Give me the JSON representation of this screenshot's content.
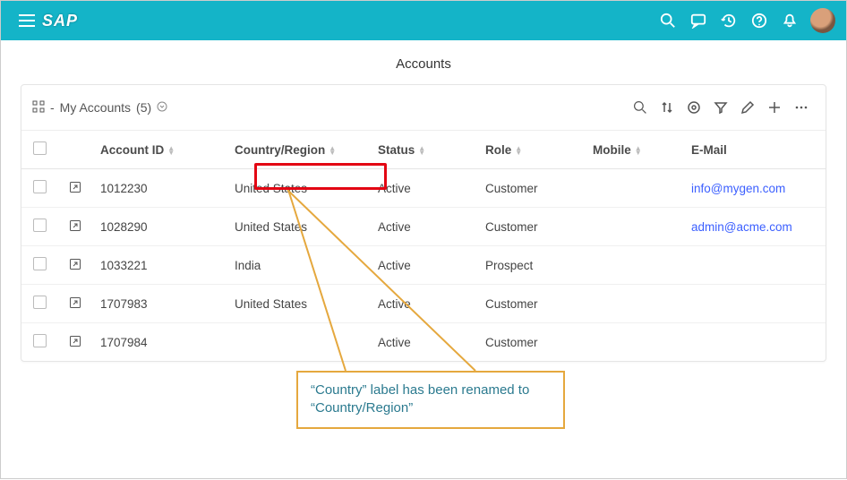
{
  "header": {
    "logo_text": "SAP"
  },
  "page": {
    "title": "Accounts"
  },
  "toolbar": {
    "view_label": "My Accounts",
    "count": "(5)"
  },
  "columns": {
    "account_id": "Account ID",
    "country_region": "Country/Region",
    "status": "Status",
    "role": "Role",
    "mobile": "Mobile",
    "email": "E-Mail"
  },
  "rows": [
    {
      "account_id": "1012230",
      "country": "United States",
      "status": "Active",
      "role": "Customer",
      "mobile": "",
      "email": "info@mygen.com"
    },
    {
      "account_id": "1028290",
      "country": "United States",
      "status": "Active",
      "role": "Customer",
      "mobile": "",
      "email": "admin@acme.com"
    },
    {
      "account_id": "1033221",
      "country": "India",
      "status": "Active",
      "role": "Prospect",
      "mobile": "",
      "email": ""
    },
    {
      "account_id": "1707983",
      "country": "United States",
      "status": "Active",
      "role": "Customer",
      "mobile": "",
      "email": ""
    },
    {
      "account_id": "1707984",
      "country": "",
      "status": "Active",
      "role": "Customer",
      "mobile": "",
      "email": ""
    }
  ],
  "callout": {
    "text": "“Country” label has been renamed to “Country/Region”"
  }
}
